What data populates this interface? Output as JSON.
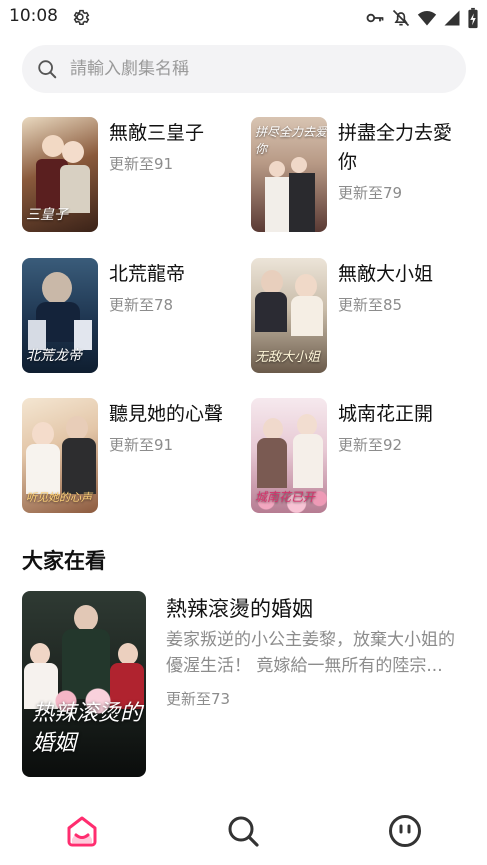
{
  "status_bar": {
    "time": "10:08",
    "icons": [
      "settings-gear-icon",
      "vpn-key-icon",
      "notifications-off-icon",
      "wifi-icon",
      "cellular-signal-icon",
      "battery-charging-icon"
    ]
  },
  "search": {
    "placeholder": "請輸入劇集名稱",
    "value": ""
  },
  "dramas": [
    {
      "title": "無敵三皇子",
      "subtitle": "更新至91",
      "poster_text": "三皇子"
    },
    {
      "title": "拼盡全力去愛你",
      "subtitle": "更新至79",
      "poster_text": "拼尽全力去爱你"
    },
    {
      "title": "北荒龍帝",
      "subtitle": "更新至78",
      "poster_text": "北荒龙帝"
    },
    {
      "title": "無敵大小姐",
      "subtitle": "更新至85",
      "poster_text": "无敌大小姐"
    },
    {
      "title": "聽見她的心聲",
      "subtitle": "更新至91",
      "poster_text": "听见她的心声"
    },
    {
      "title": "城南花正開",
      "subtitle": "更新至92",
      "poster_text": "城南花已开"
    }
  ],
  "section": {
    "title": "大家在看"
  },
  "featured": {
    "title": "熱辣滾燙的婚姻",
    "description": "姜家叛逆的小公主姜黎，放棄大小姐的優渥生活！ 竟嫁給一無所有的陸宗...",
    "subtitle": "更新至73",
    "poster_text": "热辣滚烫的婚姻"
  },
  "bottom_nav": {
    "items": [
      "home-icon",
      "search-icon",
      "profile-icon"
    ],
    "active_color": "#ff2d6f",
    "inactive_color": "#333333"
  }
}
